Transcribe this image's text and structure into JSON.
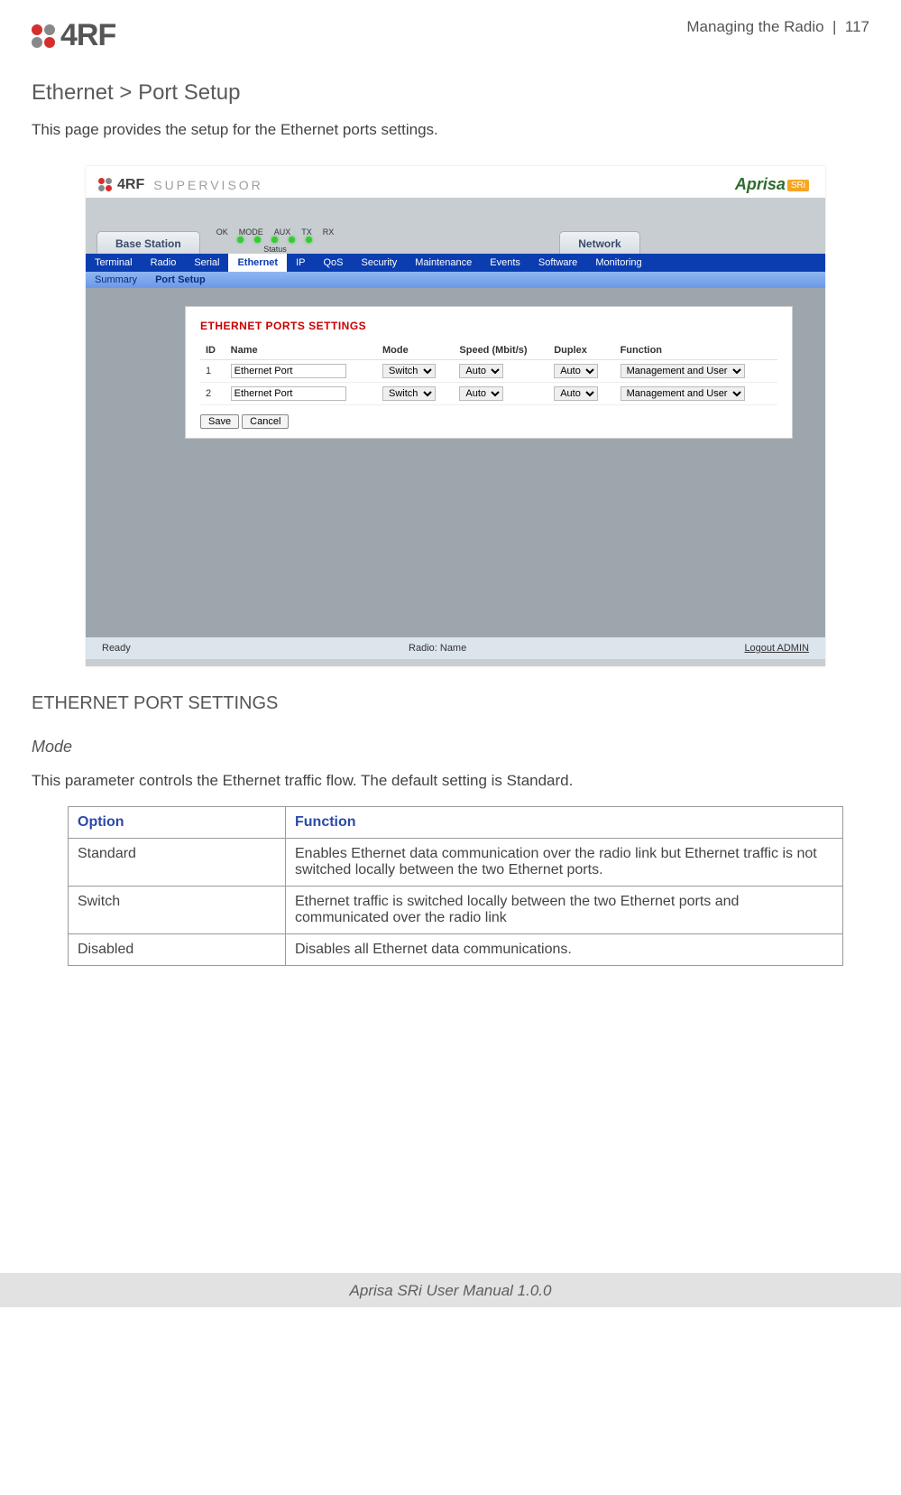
{
  "header": {
    "section": "Managing the Radio",
    "sep": "|",
    "page": "117",
    "logo": "4RF"
  },
  "breadcrumb": "Ethernet > Port Setup",
  "lead": "This page provides the setup for the Ethernet ports settings.",
  "screenshot": {
    "supervisor_brand": "4RF",
    "supervisor_word": "SUPERVISOR",
    "aprisa": "Aprisa",
    "aprisa_badge": "SRi",
    "station_tab": "Base Station",
    "network_tab": "Network",
    "leds": {
      "labels": [
        "OK",
        "MODE",
        "AUX",
        "TX",
        "RX"
      ],
      "caption": "Status"
    },
    "nav": [
      "Terminal",
      "Radio",
      "Serial",
      "Ethernet",
      "IP",
      "QoS",
      "Security",
      "Maintenance",
      "Events",
      "Software",
      "Monitoring"
    ],
    "nav_active": "Ethernet",
    "subnav": [
      "Summary",
      "Port Setup"
    ],
    "subnav_active": "Port Setup",
    "panel_title": "ETHERNET PORTS SETTINGS",
    "cols": {
      "id": "ID",
      "name": "Name",
      "mode": "Mode",
      "speed": "Speed (Mbit/s)",
      "duplex": "Duplex",
      "function": "Function"
    },
    "rows": [
      {
        "id": "1",
        "name": "Ethernet Port",
        "mode": "Switch",
        "speed": "Auto",
        "duplex": "Auto",
        "function": "Management and User"
      },
      {
        "id": "2",
        "name": "Ethernet Port",
        "mode": "Switch",
        "speed": "Auto",
        "duplex": "Auto",
        "function": "Management and User"
      }
    ],
    "save": "Save",
    "cancel": "Cancel",
    "status_left": "Ready",
    "status_mid": "Radio: Name",
    "status_right": "Logout ADMIN"
  },
  "section_title": "ETHERNET PORT SETTINGS",
  "subsection": "Mode",
  "subsection_desc": "This parameter controls the Ethernet traffic flow. The default setting is Standard.",
  "opt_table": {
    "head": {
      "option": "Option",
      "function": "Function"
    },
    "rows": [
      {
        "option": "Standard",
        "function": "Enables Ethernet data communication over the radio link but Ethernet traffic is not switched locally between the two Ethernet ports."
      },
      {
        "option": "Switch",
        "function": "Ethernet traffic is switched locally between the two Ethernet ports and communicated over the radio link"
      },
      {
        "option": "Disabled",
        "function": "Disables all Ethernet data communications."
      }
    ]
  },
  "footer": "Aprisa SRi User Manual 1.0.0"
}
